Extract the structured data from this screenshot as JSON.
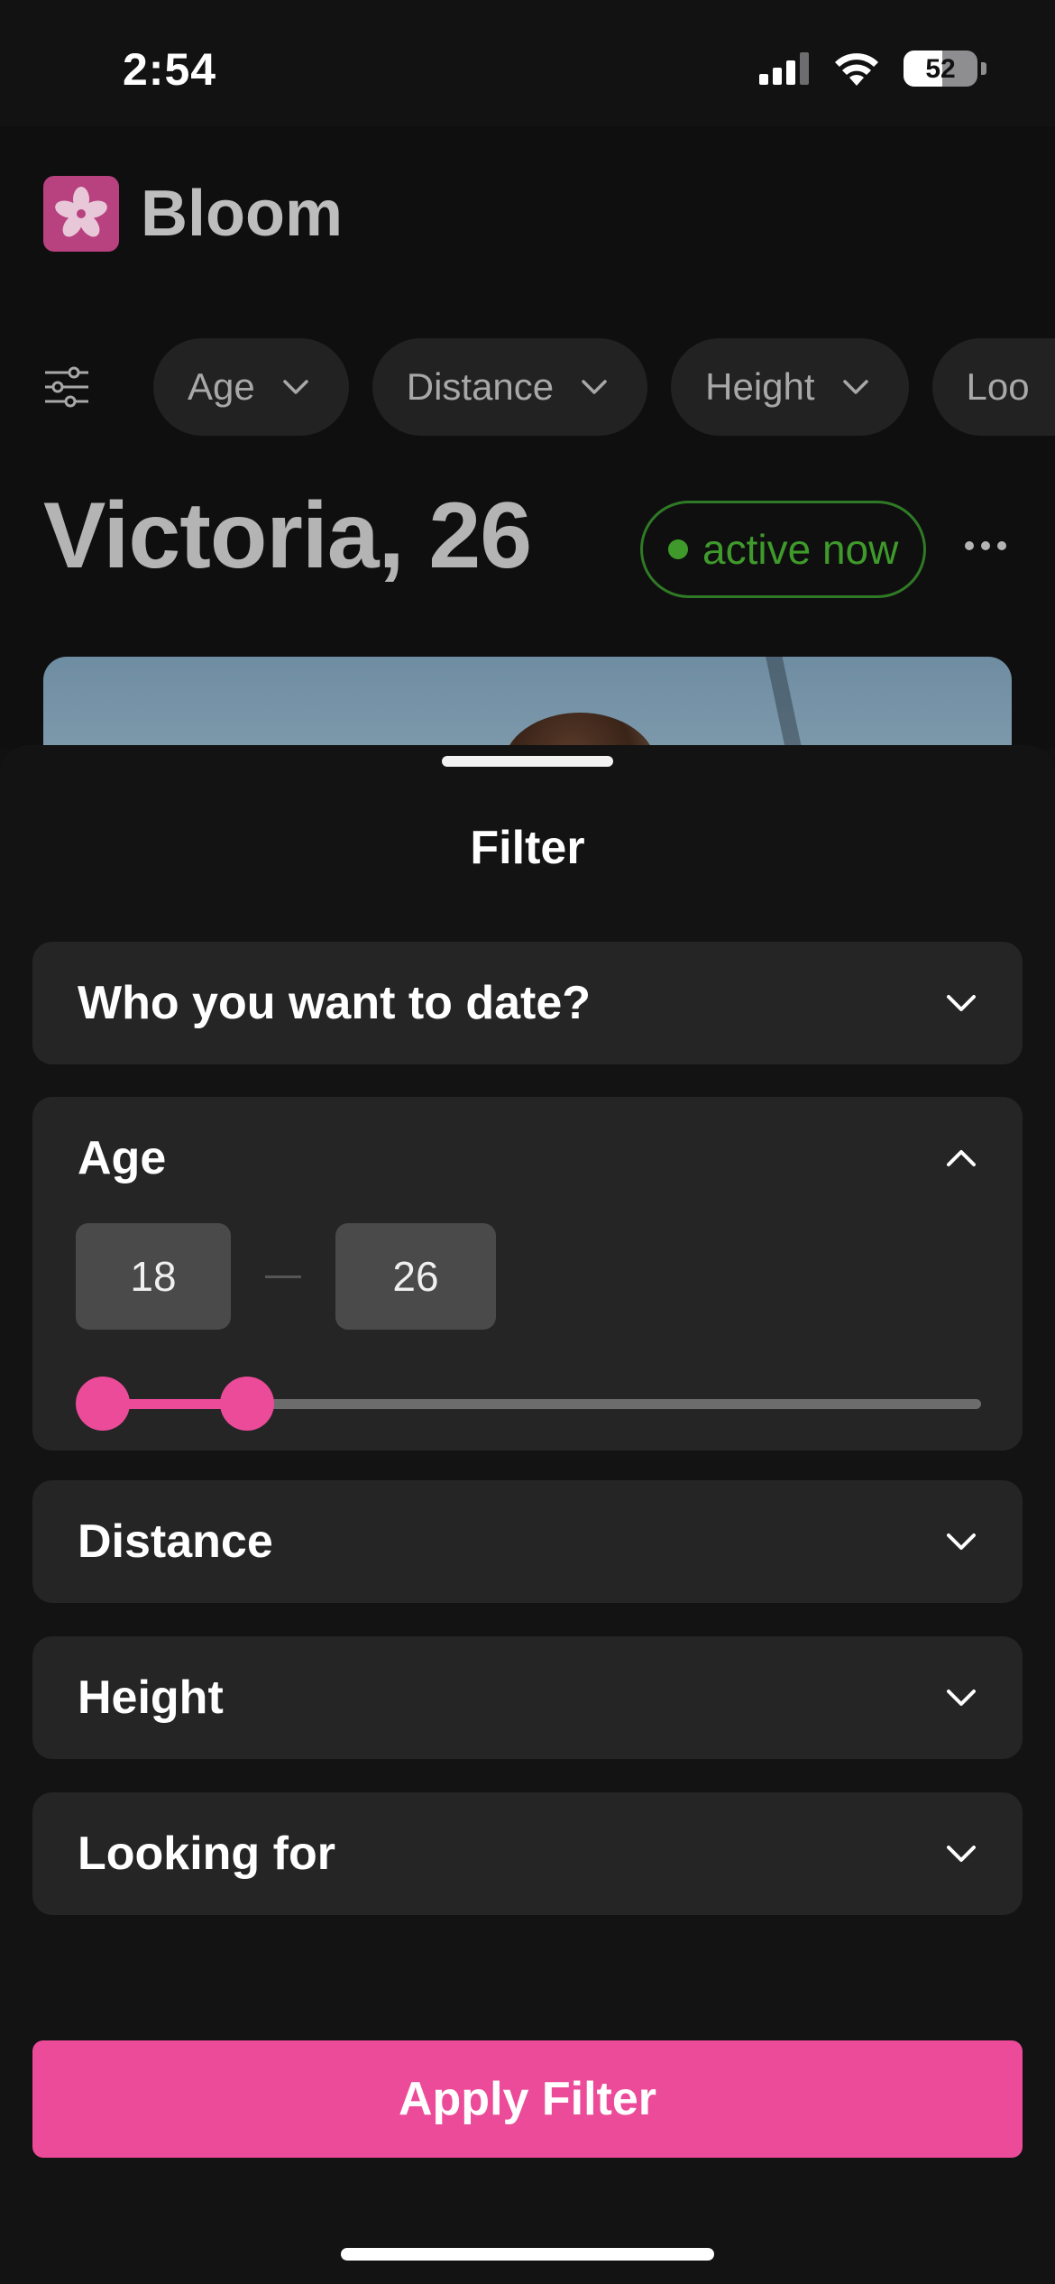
{
  "status_bar": {
    "time": "2:54",
    "battery_level": "52",
    "battery_fraction": 0.52
  },
  "app": {
    "name": "Bloom",
    "brand_color": "#b8417f",
    "filter_chips": [
      {
        "label": "Age",
        "icon": "chevron-down-icon"
      },
      {
        "label": "Distance",
        "icon": "chevron-down-icon"
      },
      {
        "label": "Height",
        "icon": "chevron-down-icon"
      },
      {
        "label": "Loo",
        "icon": "chevron-down-icon"
      }
    ],
    "profile": {
      "name_age": "Victoria, 26",
      "status": "active now",
      "status_color": "#3f9a2b"
    }
  },
  "sheet": {
    "title": "Filter",
    "sections": {
      "who": {
        "label": "Who you want to date?",
        "expanded": false
      },
      "age": {
        "label": "Age",
        "expanded": true,
        "min": "18",
        "max": "26",
        "slider_low_fraction": 0.0,
        "slider_high_fraction": 0.17
      },
      "distance": {
        "label": "Distance",
        "expanded": false
      },
      "height": {
        "label": "Height",
        "expanded": false
      },
      "looking_for": {
        "label": "Looking for",
        "expanded": false
      }
    },
    "apply_label": "Apply Filter",
    "accent_color": "#ec4b99"
  }
}
